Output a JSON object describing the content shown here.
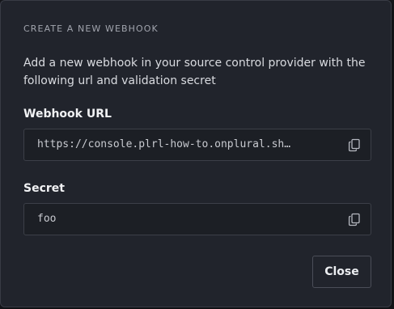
{
  "modal": {
    "header": "CREATE A NEW WEBHOOK",
    "description": "Add a new webhook in your source control provider with the following url and validation secret",
    "url_field": {
      "label": "Webhook URL",
      "value": "https://console.plrl-how-to.onplural.sh…",
      "icon": "copy-icon"
    },
    "secret_field": {
      "label": "Secret",
      "value": "foo",
      "icon": "copy-icon"
    },
    "close_label": "Close"
  },
  "colors": {
    "modal_bg": "#21242c",
    "field_bg": "#1c1f25",
    "border": "#3c3f48",
    "text_primary": "#f1f2f4",
    "text_muted": "#a1a4ad"
  }
}
